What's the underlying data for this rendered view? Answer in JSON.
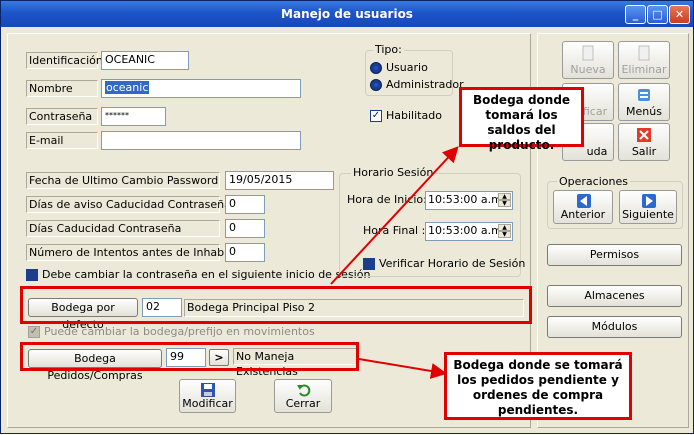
{
  "window": {
    "title": "Manejo de usuarios",
    "controls": {
      "minimize": "_",
      "maximize": "□",
      "close": "✕"
    }
  },
  "fields": {
    "identificacion": {
      "label": "Identificación",
      "value": "OCEANIC"
    },
    "nombre": {
      "label": "Nombre",
      "value": "oceanic"
    },
    "contrasena": {
      "label": "Contraseña",
      "value": "******"
    },
    "email": {
      "label": "E-mail",
      "value": ""
    },
    "fecha_ultimo_cambio": {
      "label": "Fecha de Ultimo Cambio Password",
      "value": "19/05/2015"
    },
    "dias_aviso": {
      "label": "Días de aviso Caducidad Contraseña",
      "value": "0"
    },
    "dias_caducidad": {
      "label": "Días Caducidad Contraseña",
      "value": "0"
    },
    "intentos": {
      "label": "Número de Intentos antes de Inhabilitar",
      "value": "0"
    },
    "debe_cambiar": "Debe cambiar la contraseña en el siguiente inicio de sesión"
  },
  "tipo": {
    "title": "Tipo:",
    "options": [
      "Usuario",
      "Administrador"
    ],
    "habilitado": "Habilitado"
  },
  "horario": {
    "title": "Horario Sesión",
    "inicio_label": "Hora de Inicio:",
    "inicio_value": "10:53:00 a.m.",
    "final_label": "Hora Final :",
    "final_value": "10:53:00 a.m.",
    "verificar": "Verificar Horario de Sesión"
  },
  "bodega": {
    "button": "Bodega por defecto",
    "code": "02",
    "name": "Bodega Principal Piso 2",
    "puede_cambiar": "Puede cambiar la bodega/prefijo en movimientos"
  },
  "pedidos": {
    "button": "Bodega Pedidos/Compras",
    "code": "99",
    "go": ">",
    "name": "No Maneja Existencias"
  },
  "bottom_buttons": {
    "modificar": "Modificar",
    "cerrar": "Cerrar"
  },
  "toolbar": {
    "nueva": "Nueva",
    "eliminar": "Eliminar",
    "modificar_partial": "ficar",
    "menus": "Menús",
    "ayuda_partial": "uda",
    "salir": "Salir"
  },
  "operaciones": {
    "title": "Operaciones",
    "anterior": "Anterior",
    "siguiente": "Siguiente"
  },
  "side_buttons": {
    "permisos": "Permisos",
    "almacenes": "Almacenes",
    "modulos": "Módulos"
  },
  "callouts": {
    "top": "Bodega donde tomará los saldos del producto.",
    "bottom": "Bodega donde se tomará los pedidos pendiente y ordenes de compra pendientes."
  },
  "colors": {
    "annotation": "#e00000",
    "titlebar": "#1c55c8"
  }
}
